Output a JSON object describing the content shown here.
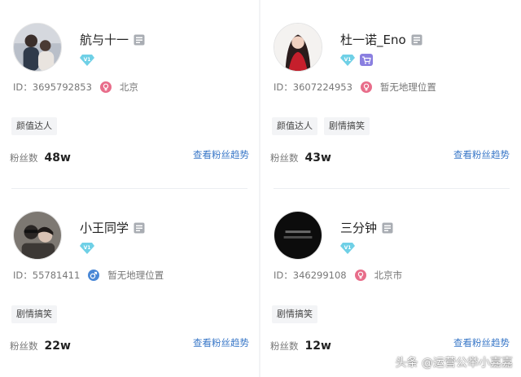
{
  "cards": [
    {
      "name": "航与十一",
      "id_text": "ID：3695792853",
      "location": "北京",
      "gender": "female",
      "tags": [
        "颜值达人"
      ],
      "fans_label": "粉丝数",
      "fans_value": "48w",
      "trend_link": "查看粉丝趋势",
      "avatar": "couple-photo",
      "badges": [
        "diamond-v1"
      ]
    },
    {
      "name": "杜一诺_Eno",
      "id_text": "ID：3607224953",
      "location": "暂无地理位置",
      "gender": "female",
      "tags": [
        "颜值达人",
        "剧情搞笑"
      ],
      "fans_label": "粉丝数",
      "fans_value": "43w",
      "trend_link": "查看粉丝趋势",
      "avatar": "woman-red-dress",
      "badges": [
        "diamond-v1",
        "cart"
      ]
    },
    {
      "name": "小王同学",
      "id_text": "ID：55781411",
      "location": "暂无地理位置",
      "gender": "male",
      "tags": [
        "剧情搞笑"
      ],
      "fans_label": "粉丝数",
      "fans_value": "22w",
      "trend_link": "查看粉丝趋势",
      "avatar": "two-people-selfie",
      "badges": [
        "diamond-v1"
      ]
    },
    {
      "name": "三分钟",
      "id_text": "ID：346299108",
      "location": "北京市",
      "gender": "female",
      "tags": [
        "剧情搞笑"
      ],
      "fans_label": "粉丝数",
      "fans_value": "12w",
      "trend_link": "查看粉丝趋势",
      "avatar": "black-logo",
      "badges": [
        "diamond-v1"
      ]
    }
  ],
  "watermark": "头条 @运营公举小嘉嘉",
  "colors": {
    "link": "#3a78c8",
    "female": "#e86d8a",
    "male": "#4a88d6",
    "diamond": "#6fd0e6",
    "tag_bg": "#f3f4f6"
  }
}
